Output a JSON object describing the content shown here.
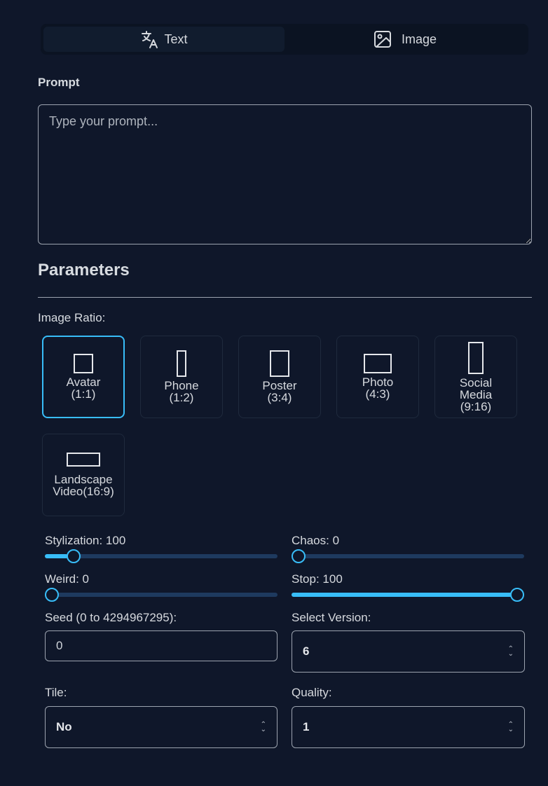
{
  "tabs": [
    {
      "label": "Text",
      "icon": "translate-icon",
      "active": true
    },
    {
      "label": "Image",
      "icon": "image-icon",
      "active": false
    }
  ],
  "prompt": {
    "label": "Prompt",
    "placeholder": "Type your prompt...",
    "value": ""
  },
  "parameters": {
    "title": "Parameters"
  },
  "image_ratio": {
    "label": "Image Ratio:",
    "options": [
      {
        "line1": "Avatar",
        "line2": "(1:1)",
        "selected": true
      },
      {
        "line1": "Phone",
        "line2": "(1:2)",
        "selected": false
      },
      {
        "line1": "Poster",
        "line2": "(3:4)",
        "selected": false
      },
      {
        "line1": "Photo",
        "line2": "(4:3)",
        "selected": false
      },
      {
        "line1": "Social",
        "line2": "Media",
        "line3": "(9:16)",
        "selected": false
      },
      {
        "line1": "Landscape",
        "line2": "Video(16:9)",
        "selected": false
      }
    ]
  },
  "sliders": {
    "stylization": {
      "label": "Stylization: 100",
      "value": 100,
      "max": 1000
    },
    "chaos": {
      "label": "Chaos: 0",
      "value": 0,
      "max": 100
    },
    "weird": {
      "label": "Weird: 0",
      "value": 0,
      "max": 3000
    },
    "stop": {
      "label": "Stop: 100",
      "value": 100,
      "max": 100
    }
  },
  "seed": {
    "label": "Seed (0 to 4294967295):",
    "value": "0"
  },
  "version": {
    "label": "Select Version:",
    "value": "6"
  },
  "tile": {
    "label": "Tile:",
    "value": "No"
  },
  "quality": {
    "label": "Quality:",
    "value": "1"
  },
  "colors": {
    "accent": "#38bdf8",
    "background": "#0f172a",
    "track": "#1e3a5f"
  }
}
